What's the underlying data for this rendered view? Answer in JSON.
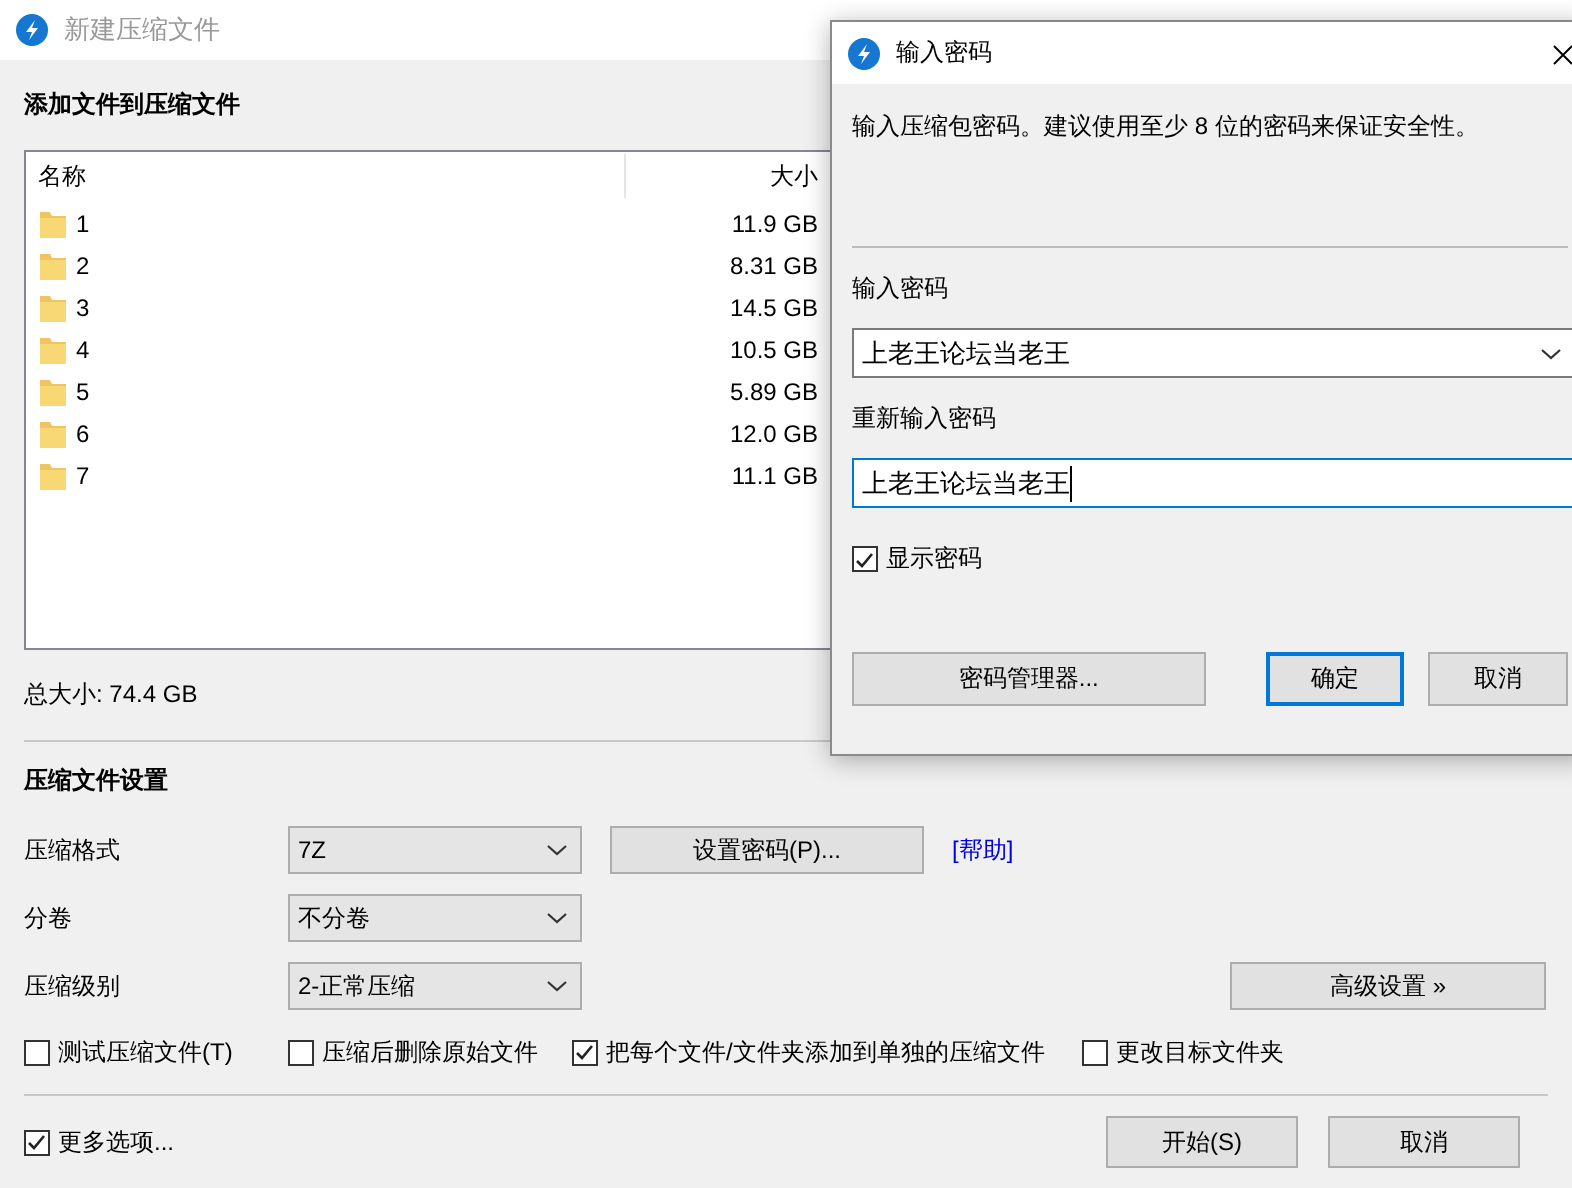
{
  "main_window": {
    "title": "新建压缩文件",
    "add_heading": "添加文件到压缩文件",
    "file_list": {
      "columns": [
        "名称",
        "大小"
      ],
      "rows": [
        {
          "name": "1",
          "size": "11.9 GB"
        },
        {
          "name": "2",
          "size": "8.31 GB"
        },
        {
          "name": "3",
          "size": "14.5 GB"
        },
        {
          "name": "4",
          "size": "10.5 GB"
        },
        {
          "name": "5",
          "size": "5.89 GB"
        },
        {
          "name": "6",
          "size": "12.0 GB"
        },
        {
          "name": "7",
          "size": "11.1 GB"
        }
      ]
    },
    "total_size": "总大小: 74.4 GB",
    "settings": {
      "heading": "压缩文件设置",
      "rows": [
        {
          "label": "压缩格式",
          "value": "7Z"
        },
        {
          "label": "分卷",
          "value": "不分卷"
        },
        {
          "label": "压缩级别",
          "value": "2-正常压缩"
        }
      ],
      "set_password_button": "设置密码(P)...",
      "help_link": "[帮助]",
      "advanced_button": "高级设置 »",
      "options": [
        {
          "label": "测试压缩文件(T)",
          "checked": false
        },
        {
          "label": "压缩后删除原始文件",
          "checked": false
        },
        {
          "label": "把每个文件/文件夹添加到单独的压缩文件",
          "checked": true
        },
        {
          "label": "更改目标文件夹",
          "checked": false
        }
      ]
    },
    "more_options": {
      "label": "更多选项...",
      "checked": true
    },
    "buttons": [
      "开始(S)",
      "取消"
    ]
  },
  "password_dialog": {
    "title": "输入密码",
    "description": "输入压缩包密码。建议使用至少 8 位的密码来保证安全性。",
    "password_label": "输入密码",
    "password_value": "上老王论坛当老王",
    "confirm_label": "重新输入密码",
    "confirm_value": "上老王论坛当老王",
    "show_password": {
      "label": "显示密码",
      "checked": true
    },
    "manager_button": "密码管理器...",
    "buttons": [
      {
        "label": "确定",
        "default": true
      },
      {
        "label": "取消",
        "default": false
      }
    ]
  }
}
